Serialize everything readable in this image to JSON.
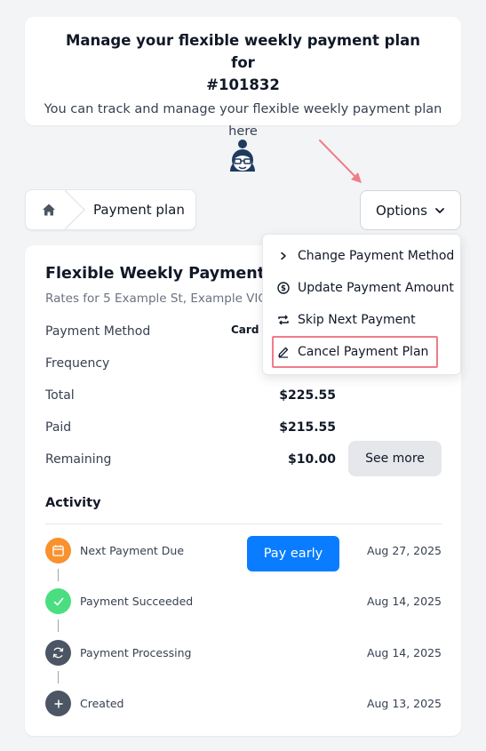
{
  "header": {
    "title_line1": "Manage your flexible weekly payment plan for",
    "title_line2": "#101832",
    "subtitle_line1": "You can track and manage your flexible weekly payment plan",
    "subtitle_line2": "here"
  },
  "breadcrumb": {
    "home_icon": "home-icon",
    "current": "Payment plan"
  },
  "options": {
    "label": "Options",
    "icon": "chevron-down-icon"
  },
  "dropdown": {
    "items": [
      {
        "label": "Change Payment Method",
        "icon": "chevron-right-icon"
      },
      {
        "label": "Update Payment Amount",
        "icon": "dollar-circle-icon"
      },
      {
        "label": "Skip Next Payment",
        "icon": "repeat-icon"
      },
      {
        "label": "Cancel Payment Plan",
        "icon": "pencil-icon"
      }
    ],
    "highlight_color": "#f07c8a"
  },
  "plan": {
    "title": "Flexible Weekly Payment 101",
    "subtitle": "Rates for 5 Example St, Example VIC /",
    "payment_method_label": "Payment Method",
    "payment_method_value": "Card *",
    "frequency_label": "Frequency",
    "total_label": "Total",
    "total_value": "$225.55",
    "paid_label": "Paid",
    "paid_value": "$215.55",
    "remaining_label": "Remaining",
    "remaining_value": "$10.00",
    "see_more": "See more"
  },
  "activity": {
    "title": "Activity",
    "pay_early": "Pay early",
    "items": [
      {
        "label": "Next Payment Due",
        "date": "Aug 27, 2025",
        "icon": "calendar-icon",
        "color": "#f7922f"
      },
      {
        "label": "Payment Succeeded",
        "date": "Aug 14, 2025",
        "icon": "check-icon",
        "color": "#4ade80"
      },
      {
        "label": "Payment Processing",
        "date": "Aug 14, 2025",
        "icon": "refresh-icon",
        "color": "#4b5563"
      },
      {
        "label": "Created",
        "date": "Aug 13, 2025",
        "icon": "plus-icon",
        "color": "#4b5563"
      }
    ]
  },
  "colors": {
    "primary": "#0a7cff",
    "arrow": "#f07c8a",
    "background": "#f3f4f6"
  }
}
